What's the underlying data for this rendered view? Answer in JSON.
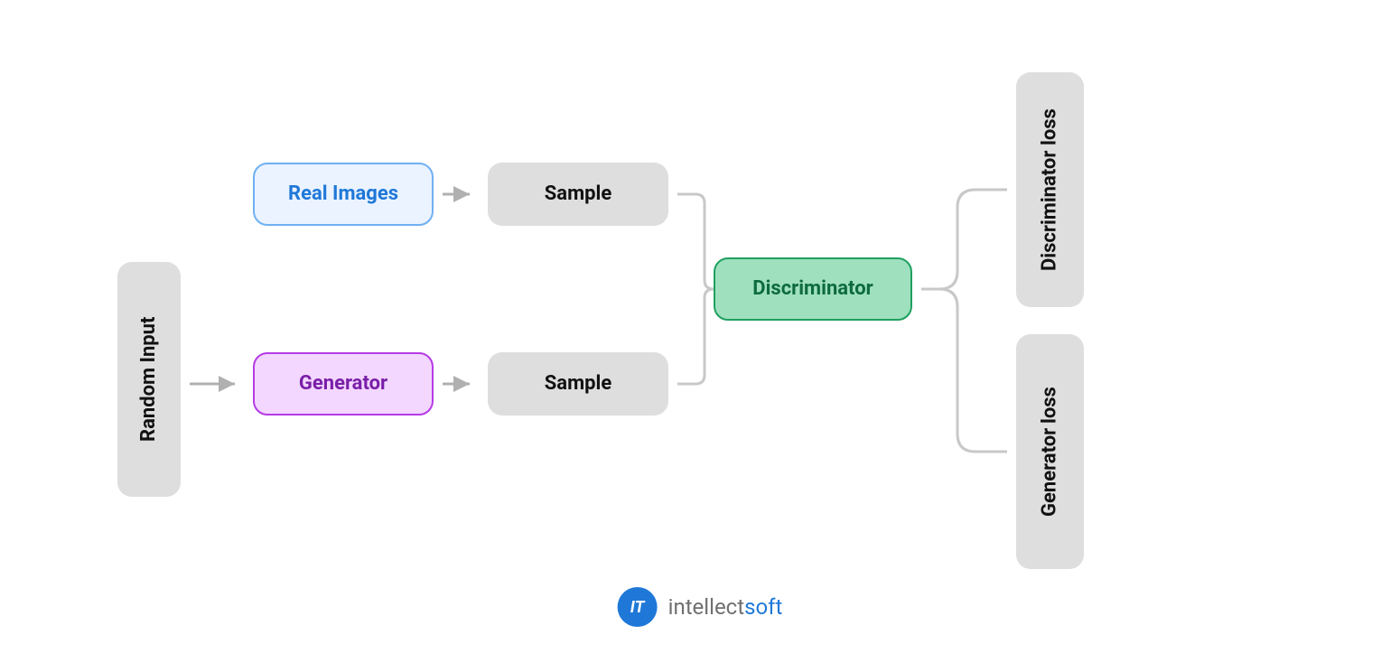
{
  "nodes": {
    "random_input": "Random Input",
    "real_images": "Real Images",
    "generator": "Generator",
    "sample_top": "Sample",
    "sample_bottom": "Sample",
    "discriminator": "Discriminator",
    "disc_loss_line1": "Discriminator",
    "disc_loss_line2": "loss",
    "gen_loss_line1": "Generator",
    "gen_loss_line2": "loss"
  },
  "logo": {
    "badge": "IT",
    "prefix": "intellect",
    "suffix": "soft"
  },
  "colors": {
    "grey": "#dedede",
    "blue_border": "#6fb0f2",
    "blue_fill": "#eaf3ff",
    "blue_text": "#1f78d8",
    "purple_border": "#b53ae6",
    "purple_fill": "#f3d7ff",
    "purple_text": "#7a1fa8",
    "green_border": "#1fa060",
    "green_fill": "#9fe0bf",
    "green_text": "#0d6b3f",
    "arrow": "#b0b0b0"
  }
}
